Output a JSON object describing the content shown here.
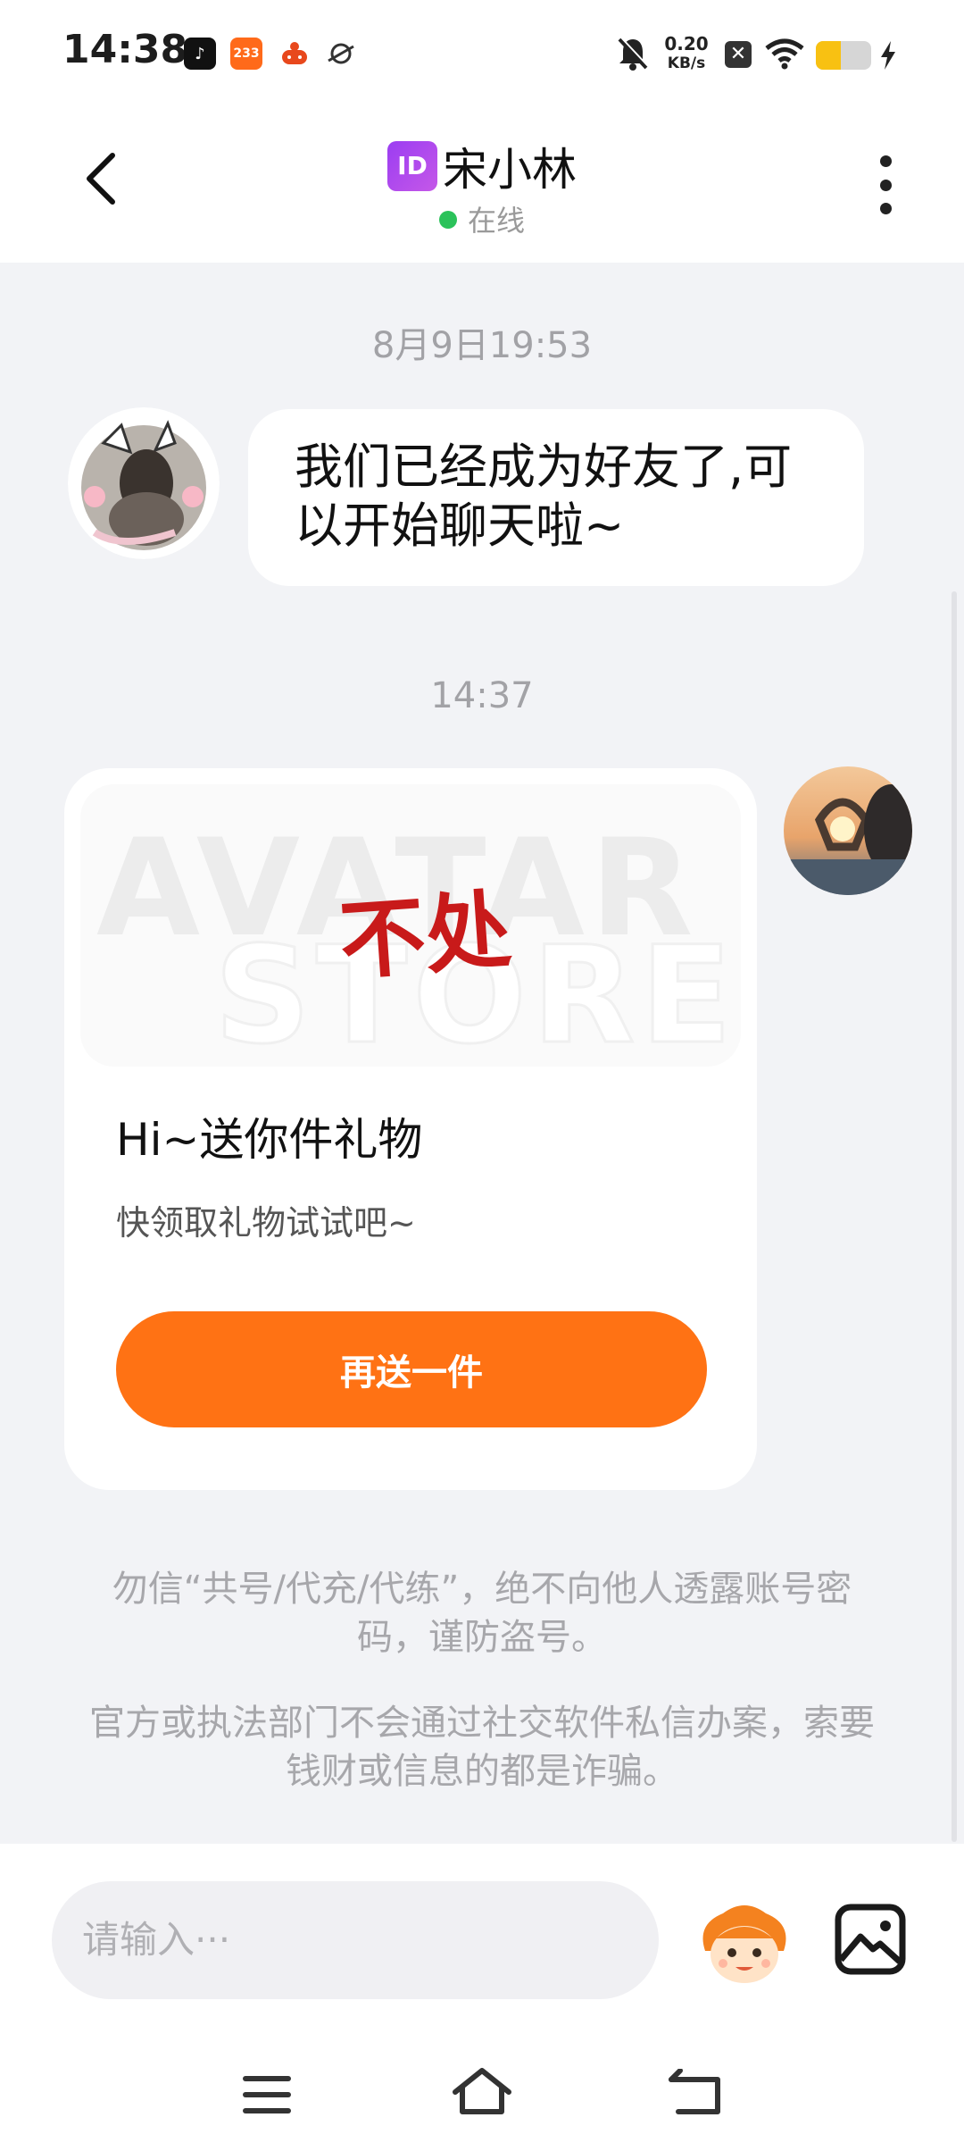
{
  "status_bar": {
    "time": "14:38",
    "app_icons": [
      "tiktok-icon",
      "233-app-icon",
      "game-icon",
      "planet-icon"
    ],
    "app233_label": "233",
    "net_speed_value": "0.20",
    "net_speed_unit": "KB/s",
    "battery_level": 0.45,
    "icons": [
      "mute-bell-icon",
      "sim-x-icon",
      "wifi-icon",
      "battery-icon",
      "charging-icon"
    ]
  },
  "header": {
    "id_badge": "ID",
    "title": "宋小林",
    "status": "在线",
    "online_color": "#2bc25a"
  },
  "chat": {
    "timestamp_1": "8月9日19:53",
    "message_1": "我们已经成为好友了,可以开始聊天啦~",
    "timestamp_2": "14:37",
    "gift_card": {
      "image_watermark_1": "AVATAR",
      "image_watermark_2": "STORE",
      "image_text": "不处",
      "title": "Hi~送你件礼物",
      "subtitle": "快领取礼物试试吧~",
      "button": "再送一件"
    },
    "notice_1": "勿信“共号/代充/代练”，绝不向他人透露账号密码，谨防盗号。",
    "notice_2": "官方或执法部门不会通过社交软件私信办案，索要钱财或信息的都是诈骗。"
  },
  "input_bar": {
    "placeholder": "请输入···"
  },
  "accent_color": "#ff7214"
}
